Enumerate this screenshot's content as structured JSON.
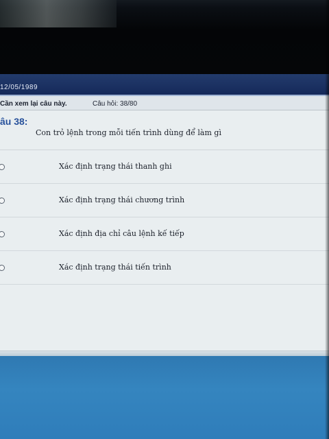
{
  "header": {
    "date": "12/05/1989"
  },
  "info_bar": {
    "review_label": "Cần xem lại câu này.",
    "question_count": "Câu hỏi: 38/80"
  },
  "question": {
    "number": "âu 38:",
    "text": "Con trỏ lệnh trong mỗi tiến trình dùng để làm gì"
  },
  "answers": [
    {
      "text": "Xác định trạng thái thanh ghi"
    },
    {
      "text": "Xác định trạng thái chương trình"
    },
    {
      "text": "Xác định địa chỉ câu lệnh kế tiếp"
    },
    {
      "text": "Xác định trạng thái tiến trình"
    }
  ],
  "colors": {
    "header_bar": "#1d3364",
    "question_number": "#27519b",
    "content_bg": "#e9eef0",
    "taskbar": "#3183bd"
  }
}
